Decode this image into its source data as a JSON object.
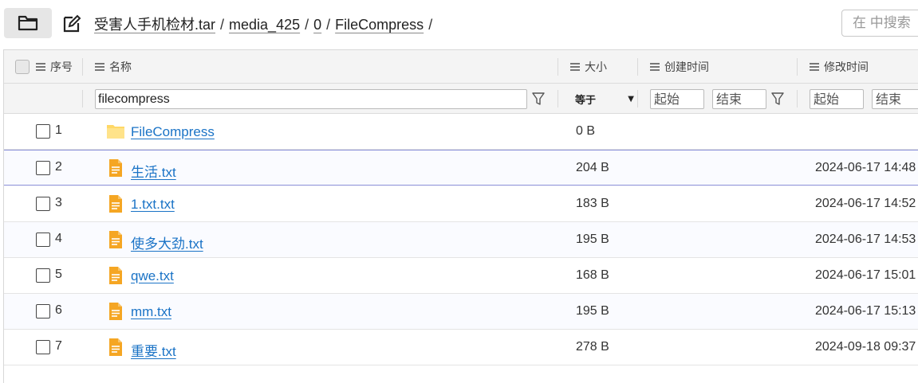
{
  "breadcrumb": {
    "items": [
      "受害人手机检材.tar",
      "media_425",
      "0",
      "FileCompress"
    ],
    "separator": "/"
  },
  "search": {
    "placeholder": "在 中搜索"
  },
  "columns": {
    "index": "序号",
    "name": "名称",
    "size": "大小",
    "created": "创建时间",
    "modified": "修改时间"
  },
  "filters": {
    "name_value": "filecompress",
    "size_operator": "等于",
    "created_start": "起始",
    "created_end": "结束",
    "modified_start": "起始",
    "modified_end": "结束"
  },
  "rows": [
    {
      "index": "1",
      "type": "folder",
      "name": "FileCompress",
      "size": "0 B",
      "modified": ""
    },
    {
      "index": "2",
      "type": "file",
      "name": "生活.txt",
      "size": "204 B",
      "modified": "2024-06-17 14:48"
    },
    {
      "index": "3",
      "type": "file",
      "name": "1.txt.txt",
      "size": "183 B",
      "modified": "2024-06-17 14:52"
    },
    {
      "index": "4",
      "type": "file",
      "name": "使多大劲.txt",
      "size": "195 B",
      "modified": "2024-06-17 14:53"
    },
    {
      "index": "5",
      "type": "file",
      "name": "qwe.txt",
      "size": "168 B",
      "modified": "2024-06-17 15:01"
    },
    {
      "index": "6",
      "type": "file",
      "name": "mm.txt",
      "size": "195 B",
      "modified": "2024-06-17 15:13"
    },
    {
      "index": "7",
      "type": "file",
      "name": "重要.txt",
      "size": "278 B",
      "modified": "2024-09-18 09:37"
    }
  ],
  "colors": {
    "link": "#1a73c6",
    "folder_icon": "#ffd866",
    "file_icon": "#f5a623",
    "selection_border": "#8a8fd8"
  },
  "icons": {
    "toolbar": [
      "folder-icon",
      "edit-icon"
    ],
    "column": "menu-icon",
    "filter": "funnel-icon",
    "folder_row": "folder-icon",
    "file_row": "text-file-icon"
  }
}
